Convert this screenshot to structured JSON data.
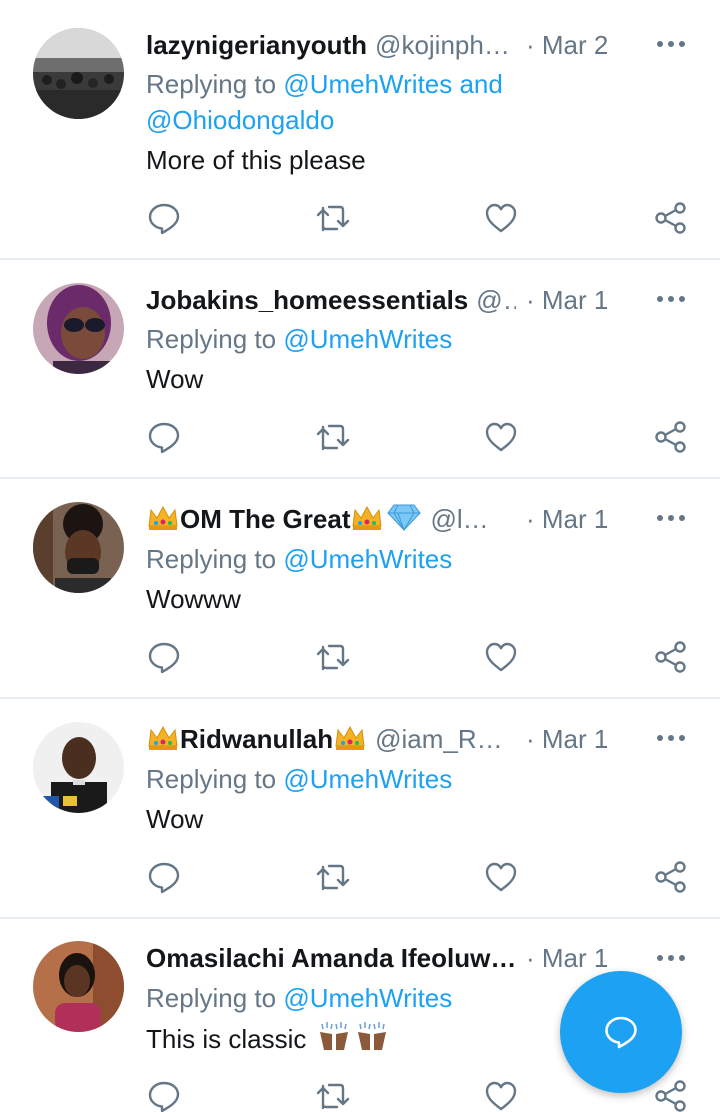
{
  "colors": {
    "accent": "#1da1f2",
    "text": "#14171a",
    "muted": "#657786",
    "divider": "#e6ecf0"
  },
  "tweets": [
    {
      "name": "lazynigerianyouth",
      "handle": "@kojinph…",
      "date": "· Mar 2",
      "replying_prefix": "Replying to ",
      "mentions": "@UmehWrites and @Ohiodongaldo",
      "text": "More of this please"
    },
    {
      "name": "Jobakins_homeessentials",
      "handle": "@..",
      "date": "· Mar 1",
      "replying_prefix": "Replying to ",
      "mentions": "@UmehWrites",
      "text": "Wow"
    },
    {
      "name": "OM The Great",
      "handle": "@la…",
      "date": "· Mar 1",
      "replying_prefix": "Replying to ",
      "mentions": "@UmehWrites",
      "text": "Wowww"
    },
    {
      "name": "Ridwanullah",
      "handle": "@iam_Re…",
      "date": "· Mar 1",
      "replying_prefix": "Replying to ",
      "mentions": "@UmehWrites",
      "text": "Wow"
    },
    {
      "name": "Omasilachi Amanda Ifeoluw…",
      "handle": "",
      "date": "· Mar 1",
      "replying_prefix": "Replying to ",
      "mentions": "@UmehWrites",
      "text": "This is classic"
    }
  ],
  "icons": {
    "reply": "reply-icon",
    "retweet": "retweet-icon",
    "like": "heart-icon",
    "share": "share-icon",
    "more": "more-icon",
    "compose": "compose-reply-icon"
  }
}
